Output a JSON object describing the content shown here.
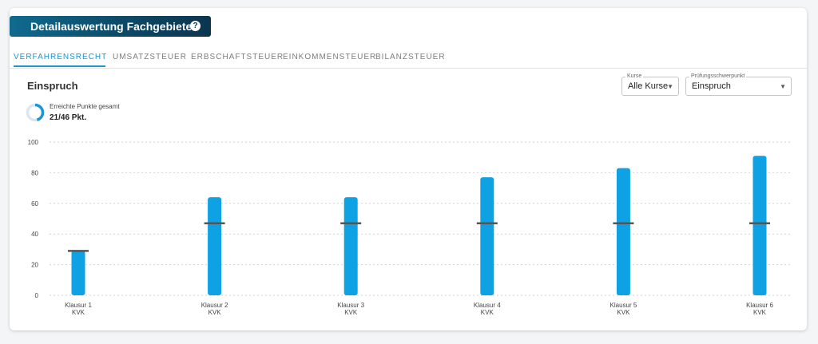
{
  "header": {
    "title": "Detailauswertung Fachgebiete",
    "help": "?"
  },
  "tabs": [
    {
      "label": "VERFAHRENSRECHT",
      "active": true
    },
    {
      "label": "UMSATZSTEUER",
      "active": false
    },
    {
      "label": "ERBSCHAFTSTEUER",
      "active": false
    },
    {
      "label": "EINKOMMENSTEUER",
      "active": false
    },
    {
      "label": "BILANZSTEUER",
      "active": false
    }
  ],
  "section": {
    "title": "Einspruch"
  },
  "filters": {
    "kurse": {
      "label": "Kurse",
      "value": "Alle Kurse"
    },
    "schwerpunkt": {
      "label": "Prüfungsschwerpunkt",
      "value": "Einspruch"
    }
  },
  "summary": {
    "label": "Erreichte Punkte gesamt",
    "value": "21/46 Pkt.",
    "progress_fraction": 0.4565
  },
  "colors": {
    "bar": "#0ea1e3",
    "marker": "#555555",
    "accent": "#1b95d4"
  },
  "chart_data": {
    "type": "bar",
    "categories": [
      "Klausur 1",
      "Klausur 2",
      "Klausur 3",
      "Klausur 4",
      "Klausur 5",
      "Klausur 6"
    ],
    "sublabels": [
      "KVK",
      "KVK",
      "KVK",
      "KVK",
      "KVK",
      "KVK"
    ],
    "series": [
      {
        "values": [
          29,
          64,
          64,
          77,
          83,
          91
        ]
      },
      {
        "values": [
          29,
          47,
          47,
          47,
          47,
          47
        ],
        "style": "marker"
      }
    ],
    "ylim": [
      0,
      100
    ],
    "yticks": [
      0,
      20,
      40,
      60,
      80,
      100
    ],
    "grid": true,
    "title": "",
    "xlabel": "",
    "ylabel": ""
  }
}
